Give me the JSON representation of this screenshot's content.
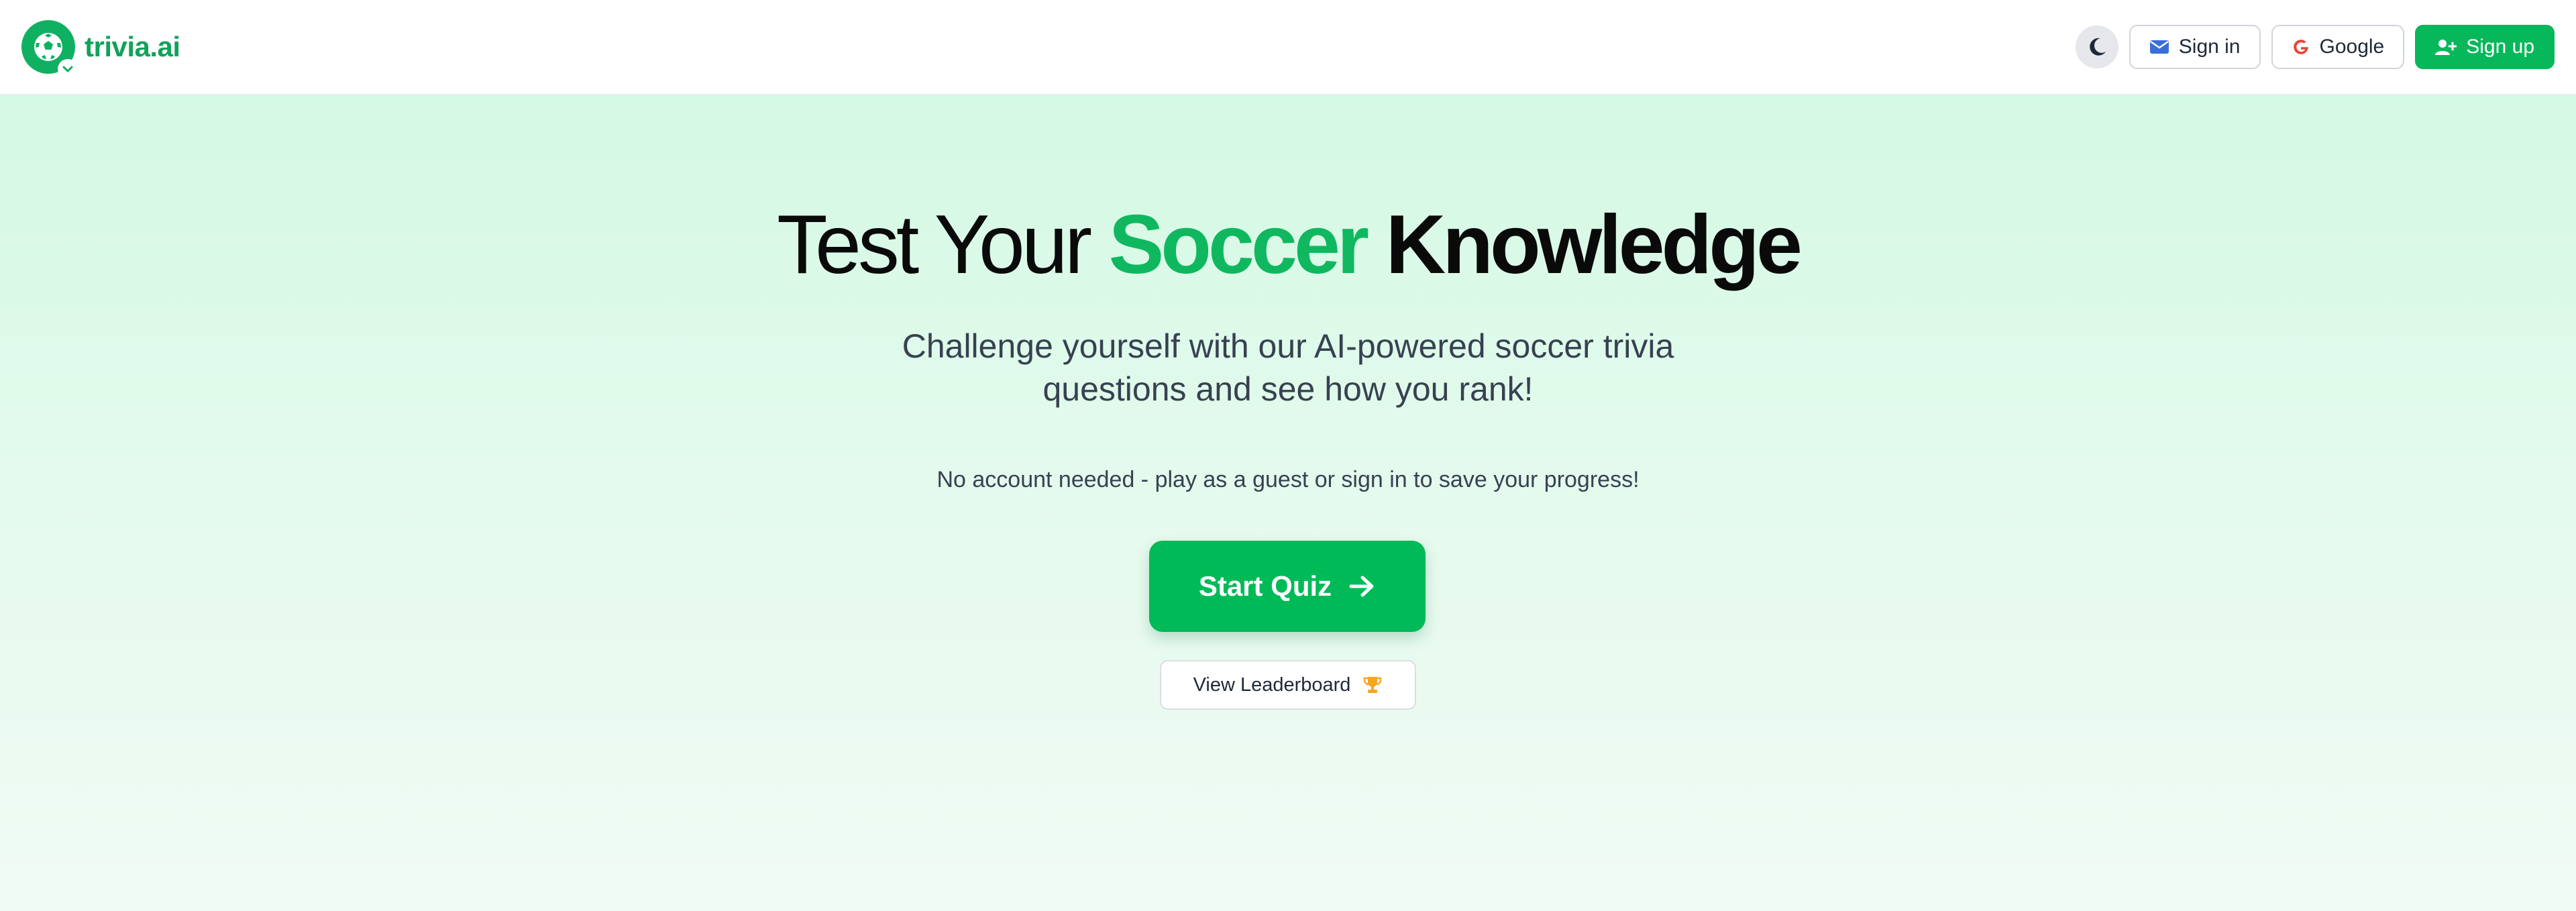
{
  "brand": {
    "name": "trivia.ai",
    "logo_icon": "soccer-ball-icon",
    "badge_icon": "chevron-down-icon",
    "color": "#10a35a"
  },
  "nav": {
    "theme_toggle_icon": "moon-icon",
    "signin_label": "Sign in",
    "signin_icon": "envelope-icon",
    "google_label": "Google",
    "google_icon": "google-icon",
    "signup_label": "Sign up",
    "signup_icon": "user-plus-icon"
  },
  "hero": {
    "title_part1": "Test Your",
    "title_accent": "Soccer",
    "title_part2": "Knowledge",
    "subtitle": "Challenge yourself with our AI-powered soccer trivia questions and see how you rank!",
    "note": "No account needed - play as a guest or sign in to save your progress!",
    "start_label": "Start Quiz",
    "start_icon": "arrow-right-icon",
    "leaderboard_label": "View Leaderboard",
    "leaderboard_icon": "trophy-icon"
  },
  "colors": {
    "accent": "#0fb85f",
    "button_green": "#00ba58",
    "hero_bg_top": "#d4f9e4",
    "hero_bg_bottom": "#f0fbf5",
    "trophy": "#f5a623"
  }
}
